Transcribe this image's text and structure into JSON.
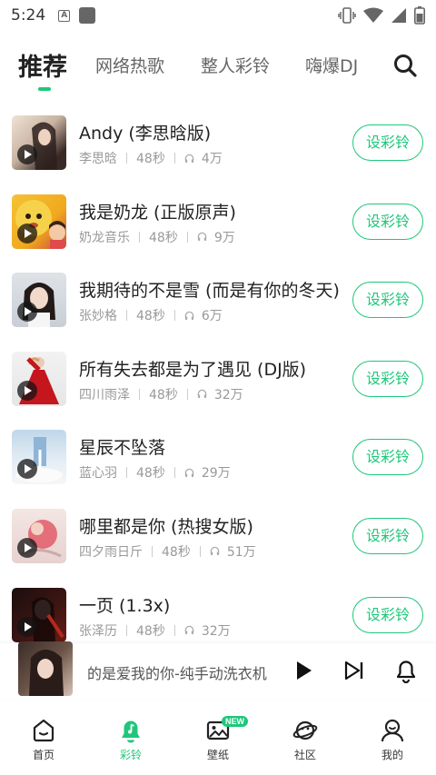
{
  "status_bar": {
    "time": "5:24"
  },
  "tabs": [
    {
      "label": "推荐",
      "active": true
    },
    {
      "label": "网络热歌",
      "active": false
    },
    {
      "label": "整人彩铃",
      "active": false
    },
    {
      "label": "嗨爆DJ",
      "active": false
    }
  ],
  "songs": [
    {
      "title": "Andy (李思晗版)",
      "artist": "李思晗",
      "duration": "48秒",
      "plays": "4万",
      "action": "设彩铃",
      "cover": "cover-woman-portrait-icon"
    },
    {
      "title": "我是奶龙 (正版原声)",
      "artist": "奶龙音乐",
      "duration": "48秒",
      "plays": "9万",
      "action": "设彩铃",
      "cover": "cover-yellow-cartoon-icon"
    },
    {
      "title": "我期待的不是雪 (而是有你的冬天)",
      "artist": "张妙格",
      "duration": "48秒",
      "plays": "6万",
      "action": "设彩铃",
      "cover": "cover-woman-portrait-icon"
    },
    {
      "title": "所有失去都是为了遇见 (DJ版)",
      "artist": "四川雨泽",
      "duration": "48秒",
      "plays": "32万",
      "action": "设彩铃",
      "cover": "cover-red-dress-icon"
    },
    {
      "title": "星辰不坠落",
      "artist": "蓝心羽",
      "duration": "48秒",
      "plays": "29万",
      "action": "设彩铃",
      "cover": "cover-blue-door-icon"
    },
    {
      "title": "哪里都是你 (热搜女版)",
      "artist": "四夕雨日斤",
      "duration": "48秒",
      "plays": "51万",
      "action": "设彩铃",
      "cover": "cover-pink-figure-icon"
    },
    {
      "title": "一页 (1.3x)",
      "artist": "张泽历",
      "duration": "48秒",
      "plays": "32万",
      "action": "设彩铃",
      "cover": "cover-dark-red-icon"
    }
  ],
  "player": {
    "title": "的是爱我的你-纯手动洗衣机"
  },
  "bottom_nav": [
    {
      "label": "首页",
      "icon": "home-icon",
      "active": false
    },
    {
      "label": "彩铃",
      "icon": "bell-music-icon",
      "active": true
    },
    {
      "label": "壁纸",
      "icon": "picture-icon",
      "active": false,
      "badge": "NEW"
    },
    {
      "label": "社区",
      "icon": "planet-icon",
      "active": false
    },
    {
      "label": "我的",
      "icon": "person-icon",
      "active": false
    }
  ],
  "colors": {
    "accent": "#1ec77a",
    "text": "#222222",
    "meta": "#999999"
  }
}
